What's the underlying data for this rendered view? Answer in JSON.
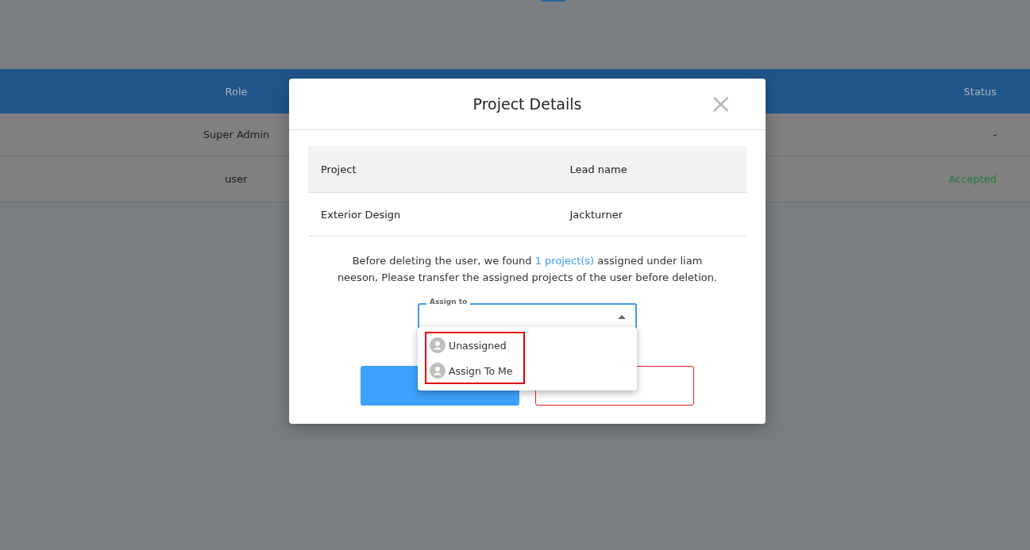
{
  "background_table": {
    "columns": [
      "Role",
      "Status"
    ],
    "rows": [
      {
        "role": "Super Admin",
        "status": "-",
        "color": "#1d1d1d"
      },
      {
        "role": "user",
        "status": "Accepted",
        "color": "#1f7a3d"
      }
    ]
  },
  "modal": {
    "title": "Project Details",
    "close": "×",
    "table": {
      "columns": [
        "Project",
        "Lead name"
      ],
      "rows": [
        [
          "Exterior Design",
          "Jackturner"
        ]
      ]
    },
    "message": {
      "before": "Before deleting the user, we found ",
      "link": "1 project(s)",
      "after": " assigned under liam neeson, Please transfer the assigned projects of the user before deletion."
    },
    "assign_field": {
      "label": "Assign to",
      "expanded": true,
      "options": [
        {
          "label": "Unassigned",
          "selected": false
        },
        {
          "label": "Assign To Me",
          "selected": false
        }
      ]
    }
  }
}
